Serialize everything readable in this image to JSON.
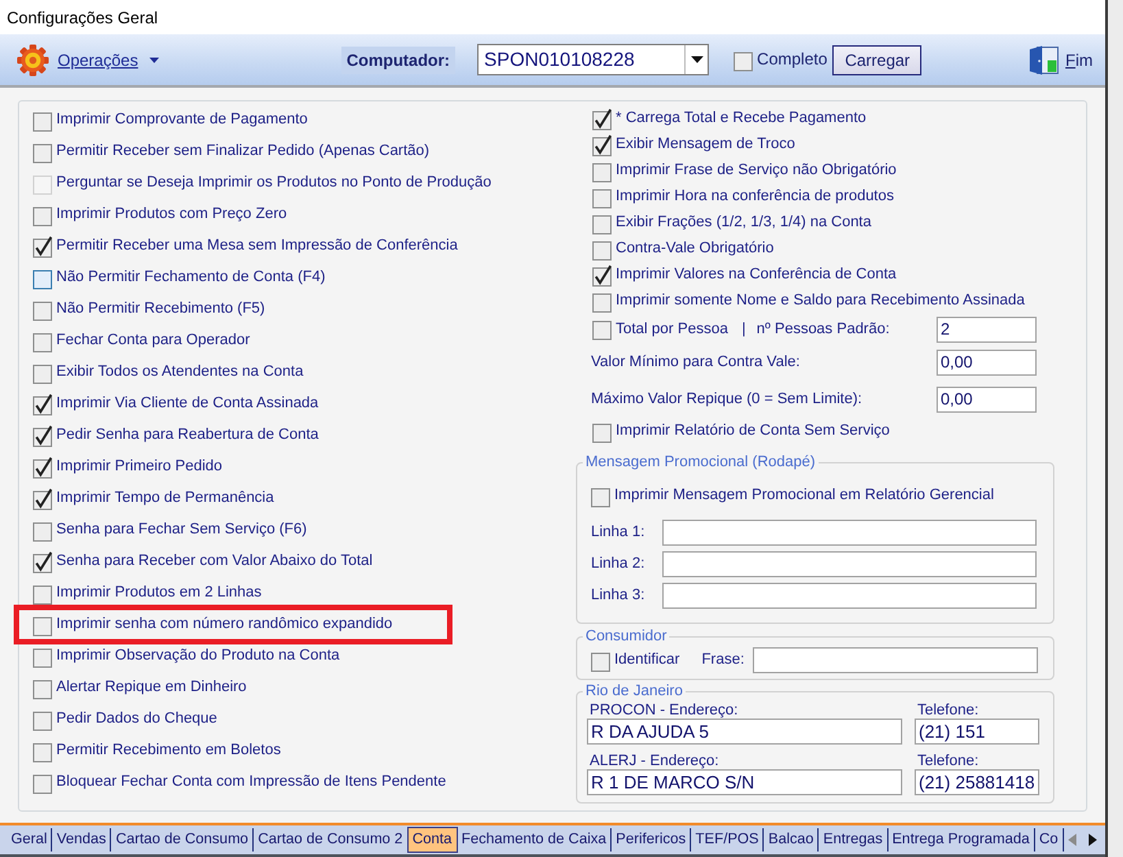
{
  "window": {
    "title": "Configurações Geral"
  },
  "toolbar": {
    "menu": {
      "label": "Operações"
    },
    "computer": {
      "label": "Computador:",
      "value": "SPON010108228"
    },
    "complete": {
      "label": "Completo",
      "checked": false
    },
    "load_button": "Carregar",
    "exit_button": "Fim"
  },
  "options_left": [
    {
      "label": "Imprimir Comprovante de Pagamento",
      "checked": false,
      "disabled": false,
      "focused": false,
      "highlighted": false
    },
    {
      "label": "Permitir Receber sem Finalizar Pedido (Apenas Cartão)",
      "checked": false,
      "disabled": false,
      "focused": false,
      "highlighted": false
    },
    {
      "label": "Perguntar se Deseja Imprimir os Produtos no Ponto de Produção",
      "checked": false,
      "disabled": true,
      "focused": false,
      "highlighted": false
    },
    {
      "label": "Imprimir Produtos com Preço Zero",
      "checked": false,
      "disabled": false,
      "focused": false,
      "highlighted": false
    },
    {
      "label": "Permitir Receber uma Mesa sem Impressão de Conferência",
      "checked": true,
      "disabled": false,
      "focused": false,
      "highlighted": false
    },
    {
      "label": "Não Permitir Fechamento de Conta (F4)",
      "checked": false,
      "disabled": false,
      "focused": true,
      "highlighted": false
    },
    {
      "label": "Não Permitir Recebimento (F5)",
      "checked": false,
      "disabled": false,
      "focused": false,
      "highlighted": false
    },
    {
      "label": "Fechar Conta para Operador",
      "checked": false,
      "disabled": false,
      "focused": false,
      "highlighted": false
    },
    {
      "label": "Exibir Todos os Atendentes na Conta",
      "checked": false,
      "disabled": false,
      "focused": false,
      "highlighted": false
    },
    {
      "label": "Imprimir Via Cliente de Conta Assinada",
      "checked": true,
      "disabled": false,
      "focused": false,
      "highlighted": false
    },
    {
      "label": "Pedir Senha para Reabertura de Conta",
      "checked": true,
      "disabled": false,
      "focused": false,
      "highlighted": false
    },
    {
      "label": "Imprimir Primeiro Pedido",
      "checked": true,
      "disabled": false,
      "focused": false,
      "highlighted": false
    },
    {
      "label": "Imprimir Tempo de Permanência",
      "checked": true,
      "disabled": false,
      "focused": false,
      "highlighted": false
    },
    {
      "label": "Senha para Fechar Sem Serviço (F6)",
      "checked": false,
      "disabled": false,
      "focused": false,
      "highlighted": false
    },
    {
      "label": "Senha para Receber com Valor Abaixo do Total",
      "checked": true,
      "disabled": false,
      "focused": false,
      "highlighted": false
    },
    {
      "label": "Imprimir Produtos em 2 Linhas",
      "checked": false,
      "disabled": false,
      "focused": false,
      "highlighted": false
    },
    {
      "label": "Imprimir senha com número randômico expandido",
      "checked": false,
      "disabled": false,
      "focused": false,
      "highlighted": true
    },
    {
      "label": "Imprimir Observação do Produto na Conta",
      "checked": false,
      "disabled": false,
      "focused": false,
      "highlighted": false
    },
    {
      "label": "Alertar Repique em Dinheiro",
      "checked": false,
      "disabled": false,
      "focused": false,
      "highlighted": false
    },
    {
      "label": "Pedir Dados do Cheque",
      "checked": false,
      "disabled": false,
      "focused": false,
      "highlighted": false
    },
    {
      "label": "Permitir Recebimento em Boletos",
      "checked": false,
      "disabled": false,
      "focused": false,
      "highlighted": false
    },
    {
      "label": "Bloquear Fechar Conta com Impressão de Itens Pendente",
      "checked": false,
      "disabled": false,
      "focused": false,
      "highlighted": false
    }
  ],
  "options_right": [
    {
      "kind": "checkbox",
      "label": "* Carrega Total e Recebe Pagamento",
      "checked": true
    },
    {
      "kind": "checkbox",
      "label": "Exibir Mensagem de Troco",
      "checked": true
    },
    {
      "kind": "checkbox",
      "label": "Imprimir Frase de Serviço não Obrigatório",
      "checked": false
    },
    {
      "kind": "checkbox",
      "label": "Imprimir Hora na conferência de produtos",
      "checked": false
    },
    {
      "kind": "checkbox",
      "label": "Exibir Frações (1/2, 1/3, 1/4) na Conta",
      "checked": false
    },
    {
      "kind": "checkbox",
      "label": "Contra-Vale Obrigatório",
      "checked": false
    },
    {
      "kind": "checkbox",
      "label": "Imprimir Valores na Conferência de Conta",
      "checked": true
    },
    {
      "kind": "checkbox",
      "label": "Imprimir somente Nome e Saldo para Recebimento Assinada",
      "checked": false
    },
    {
      "kind": "checkbox_field",
      "label": "Total por Pessoa",
      "checked": false,
      "separator": "|",
      "field_label": "nº Pessoas Padrão:",
      "value": "2"
    },
    {
      "kind": "field",
      "label": "Valor Mínimo para Contra Vale:",
      "value": "0,00"
    },
    {
      "kind": "field",
      "label": "Máximo Valor Repique (0 = Sem Limite):",
      "value": "0,00"
    },
    {
      "kind": "checkbox",
      "label": "Imprimir Relatório de Conta Sem Serviço",
      "checked": false
    }
  ],
  "promo_message": {
    "legend": "Mensagem Promocional (Rodapé)",
    "option": {
      "label": "Imprimir Mensagem Promocional em Relatório Gerencial",
      "checked": false
    },
    "lines": [
      {
        "label": "Linha 1:"
      },
      {
        "label": "Linha 2:"
      },
      {
        "label": "Linha 3:"
      }
    ]
  },
  "consumer": {
    "legend": "Consumidor",
    "option": {
      "label": "Identificar",
      "checked": false
    },
    "phrase_label": "Frase:"
  },
  "contacts": {
    "legend": "Rio de Janeiro",
    "entries": [
      {
        "address_label": "PROCON - Endereço:",
        "address": "R DA AJUDA 5",
        "phone_label": "Telefone:",
        "phone": "(21) 151"
      },
      {
        "address_label": "ALERJ - Endereço:",
        "address": "R 1 DE MARCO S/N",
        "phone_label": "Telefone:",
        "phone": "(21) 25881418"
      }
    ]
  },
  "tabs": [
    {
      "label": "Geral",
      "selected": false
    },
    {
      "label": "Vendas",
      "selected": false
    },
    {
      "label": "Cartao de Consumo",
      "selected": false
    },
    {
      "label": "Cartao de Consumo 2",
      "selected": false
    },
    {
      "label": "Conta",
      "selected": true
    },
    {
      "label": "Fechamento de Caixa",
      "selected": false
    },
    {
      "label": "Perifericos",
      "selected": false
    },
    {
      "label": "TEF/POS",
      "selected": false
    },
    {
      "label": "Balcao",
      "selected": false
    },
    {
      "label": "Entregas",
      "selected": false
    },
    {
      "label": "Entrega Programada",
      "selected": false
    },
    {
      "label": "Co",
      "selected": false
    }
  ]
}
